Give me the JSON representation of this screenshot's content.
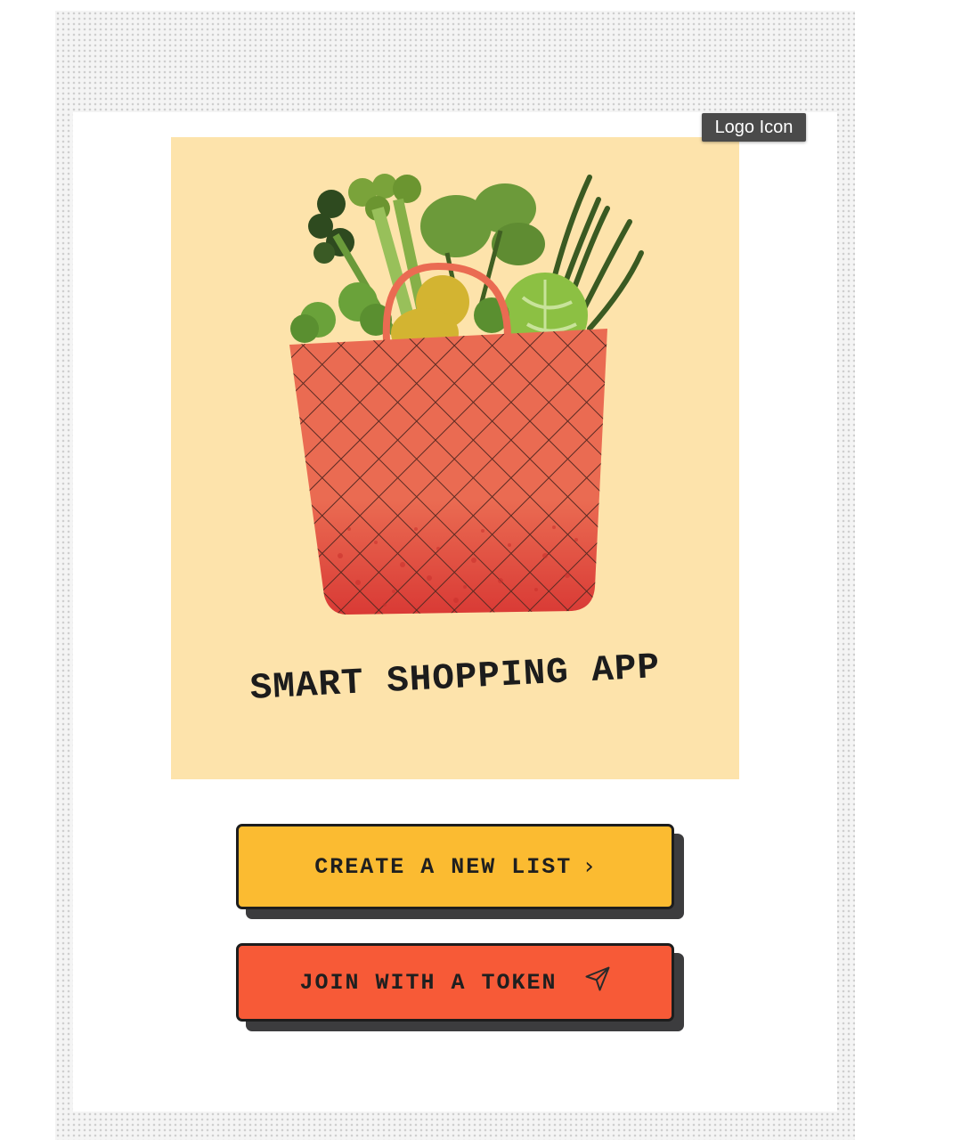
{
  "tooltip": {
    "text": "Logo Icon"
  },
  "logo": {
    "title": "SMART SHOPPING APP",
    "icon": "grocery-basket-illustration",
    "background_color": "#fde3ab",
    "basket_color": "#ea6b52"
  },
  "actions": {
    "create_label": "CREATE A NEW LIST",
    "create_icon": "chevron-right-icon",
    "create_color": "#fbbb31",
    "join_label": "JOIN WITH A TOKEN",
    "join_icon": "paper-plane-icon",
    "join_color": "#f75a37"
  }
}
